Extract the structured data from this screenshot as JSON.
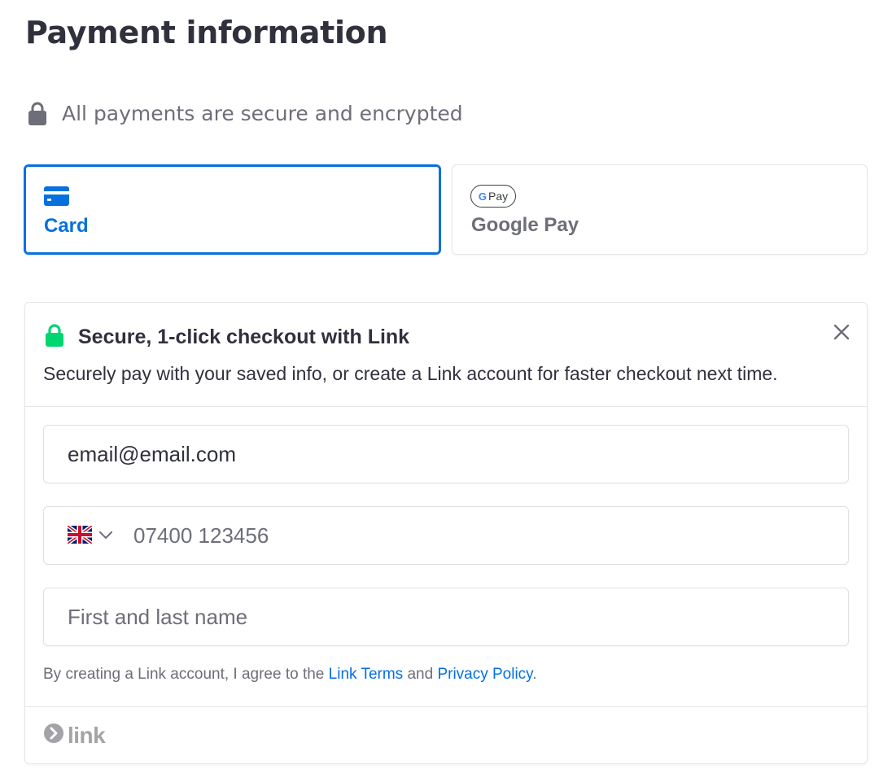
{
  "page": {
    "title": "Payment information",
    "secure_note": "All payments are secure and encrypted"
  },
  "payment_methods": [
    {
      "label": "Card",
      "icon": "credit-card-icon",
      "selected": true
    },
    {
      "label": "Google Pay",
      "icon": "google-pay-icon",
      "selected": false,
      "mark_text": "Pay",
      "mark_letter": "G"
    }
  ],
  "link": {
    "title": "Secure, 1-click checkout with Link",
    "subtitle": "Securely pay with your saved info, or create a Link account for faster checkout next time.",
    "email_value": "email@email.com",
    "phone_placeholder": "07400 123456",
    "country_flag": "united-kingdom-flag-icon",
    "name_placeholder": "First and last name",
    "terms_prefix": "By creating a Link account, I agree to the ",
    "terms_link": "Link Terms",
    "terms_and": " and ",
    "privacy_link": "Privacy Policy",
    "terms_suffix": ".",
    "logo_word": "link"
  },
  "colors": {
    "accent": "#0570de",
    "text": "#30313d",
    "muted": "#6d6e78",
    "link_green": "#00d66f",
    "border": "#e6e6e6"
  }
}
